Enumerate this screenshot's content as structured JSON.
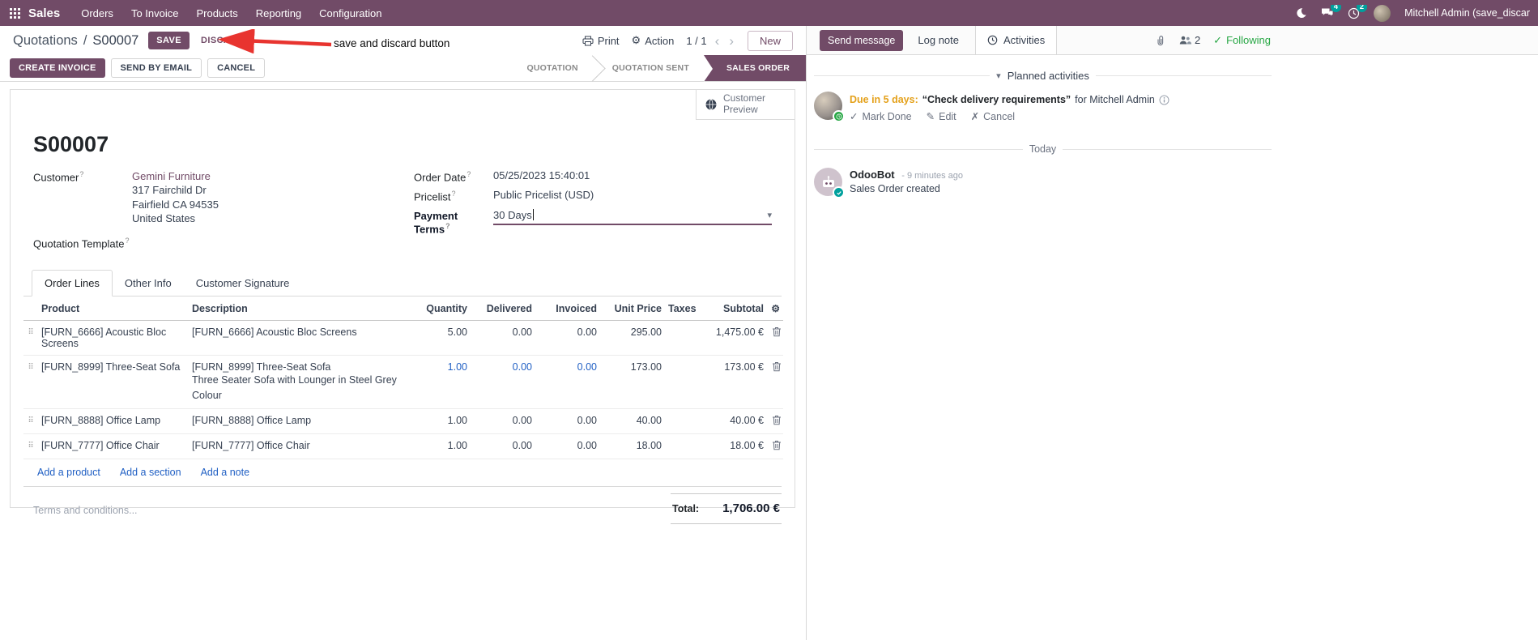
{
  "icons": {
    "caret_down": "▾",
    "check": "✓",
    "cross": "✗",
    "pencil": "✎",
    "gear": "⚙",
    "sliders": "⚙",
    "chevron_left": "‹",
    "chevron_right": "›",
    "handle": "⠿"
  },
  "nav": {
    "app_name": "Sales",
    "menus": [
      "Orders",
      "To Invoice",
      "Products",
      "Reporting",
      "Configuration"
    ],
    "messages_badge": "4",
    "activities_badge": "2",
    "user_name": "Mitchell Admin (save_discar"
  },
  "control": {
    "breadcrumb_parent": "Quotations",
    "separator": "/",
    "record_name": "S00007",
    "save": "SAVE",
    "discard": "DISCARD",
    "annotation": "save and discard button",
    "print": "Print",
    "action": "Action",
    "pager": "1 / 1",
    "new": "New"
  },
  "statusbar": {
    "create_invoice": "CREATE INVOICE",
    "send_by_email": "SEND BY EMAIL",
    "cancel": "CANCEL",
    "states": [
      {
        "label": "QUOTATION"
      },
      {
        "label": "QUOTATION SENT"
      },
      {
        "label": "SALES ORDER"
      }
    ]
  },
  "sheet": {
    "customer_preview": "Customer Preview",
    "title": "S00007",
    "help_marker": "?",
    "customer_label": "Customer",
    "customer_value": "Gemini Furniture",
    "address_line1": "317 Fairchild Dr",
    "address_line2": "Fairfield CA 94535",
    "address_line3": "United States",
    "quotation_template_label": "Quotation Template",
    "order_date_label": "Order Date",
    "order_date_value": "05/25/2023 15:40:01",
    "pricelist_label": "Pricelist",
    "pricelist_value": "Public Pricelist (USD)",
    "payment_terms_label": "Payment Terms",
    "payment_terms_value": "30 Days",
    "tabs": [
      {
        "label": "Order Lines"
      },
      {
        "label": "Other Info"
      },
      {
        "label": "Customer Signature"
      }
    ],
    "table": {
      "headers": {
        "product": "Product",
        "description": "Description",
        "quantity": "Quantity",
        "delivered": "Delivered",
        "invoiced": "Invoiced",
        "unit_price": "Unit Price",
        "taxes": "Taxes",
        "subtotal": "Subtotal"
      },
      "rows": [
        {
          "product": "[FURN_6666] Acoustic Bloc Screens",
          "description": "[FURN_6666] Acoustic Bloc Screens",
          "description2": "",
          "quantity": "5.00",
          "delivered": "0.00",
          "invoiced": "0.00",
          "unit_price": "295.00",
          "taxes": "",
          "subtotal": "1,475.00 €"
        },
        {
          "product": "[FURN_8999] Three-Seat Sofa",
          "description": "[FURN_8999] Three-Seat Sofa",
          "description2": "Three Seater Sofa with Lounger in Steel Grey Colour",
          "quantity": "1.00",
          "delivered": "0.00",
          "invoiced": "0.00",
          "unit_price": "173.00",
          "taxes": "",
          "subtotal": "173.00 €"
        },
        {
          "product": "[FURN_8888] Office Lamp",
          "description": "[FURN_8888] Office Lamp",
          "description2": "",
          "quantity": "1.00",
          "delivered": "0.00",
          "invoiced": "0.00",
          "unit_price": "40.00",
          "taxes": "",
          "subtotal": "40.00 €"
        },
        {
          "product": "[FURN_7777] Office Chair",
          "description": "[FURN_7777] Office Chair",
          "description2": "",
          "quantity": "1.00",
          "delivered": "0.00",
          "invoiced": "0.00",
          "unit_price": "18.00",
          "taxes": "",
          "subtotal": "18.00 €"
        }
      ],
      "add_product": "Add a product",
      "add_section": "Add a section",
      "add_note": "Add a note"
    },
    "terms_placeholder": "Terms and conditions...",
    "total_label": "Total:",
    "total_value": "1,706.00 €"
  },
  "chatter": {
    "send_message": "Send message",
    "log_note": "Log note",
    "activities": "Activities",
    "followers_count": "2",
    "following": "Following",
    "planned_header": "Planned activities",
    "activity": {
      "due": "Due in 5 days:",
      "summary": "“Check delivery requirements”",
      "assignee": "for Mitchell Admin",
      "mark_done": "Mark Done",
      "edit": "Edit",
      "cancel": "Cancel"
    },
    "today": "Today",
    "message": {
      "author": "OdooBot",
      "time": "- 9 minutes ago",
      "body": "Sales Order created"
    }
  }
}
